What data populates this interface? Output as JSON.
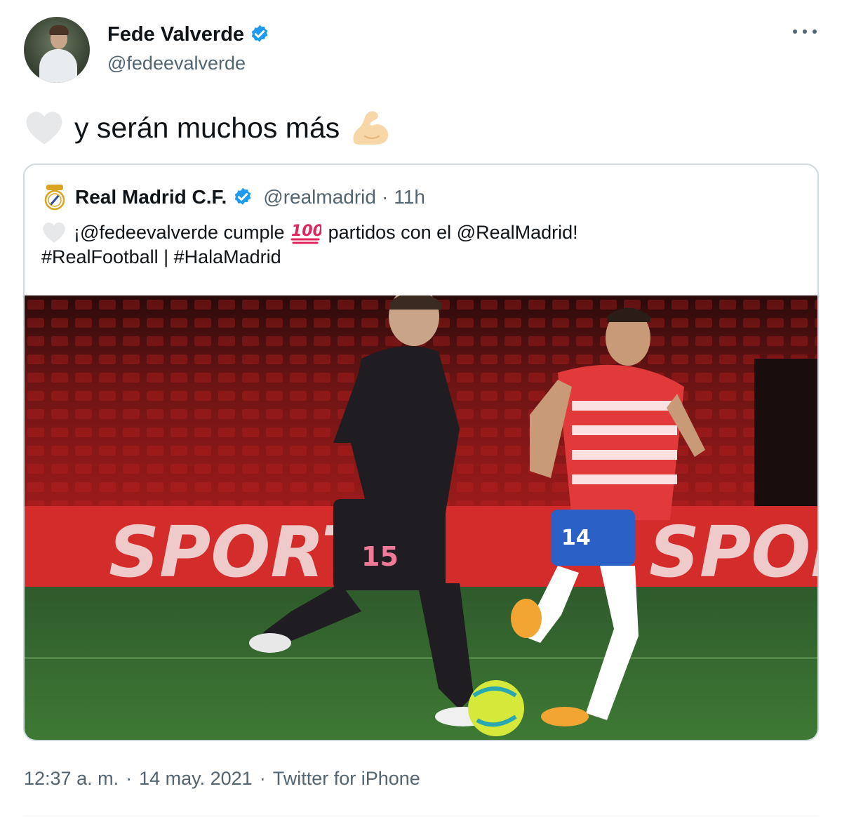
{
  "author": {
    "name": "Fede Valverde",
    "handle": "@fedeevalverde",
    "verified": true
  },
  "tweet": {
    "text": "y serán muchos más",
    "leading_icon": "white-heart-icon",
    "trailing_icon": "flexed-biceps-icon"
  },
  "quoted_tweet": {
    "name": "Real Madrid C.F.",
    "handle": "@realmadrid",
    "separator": "·",
    "time": "11h",
    "line1_part1": "¡@fedeevalverde cumple",
    "line1_part2": "partidos con el @RealMadrid!",
    "line2": "#RealFootball | #HalaMadrid",
    "icons": [
      "white-heart-icon",
      "hundred-points-icon",
      "real-madrid-crest-icon"
    ],
    "media": {
      "kind": "photo",
      "banner_text": "SPORT",
      "player_number_left": "15",
      "player_number_right": "14"
    }
  },
  "footer": {
    "time": "12:37 a. m.",
    "separator": "·",
    "date": "14 may. 2021",
    "source": "Twitter for iPhone"
  },
  "colors": {
    "text_primary": "#0f1419",
    "text_secondary": "#536471",
    "verified_blue": "#1d9bf0",
    "border": "#cfd9de"
  }
}
